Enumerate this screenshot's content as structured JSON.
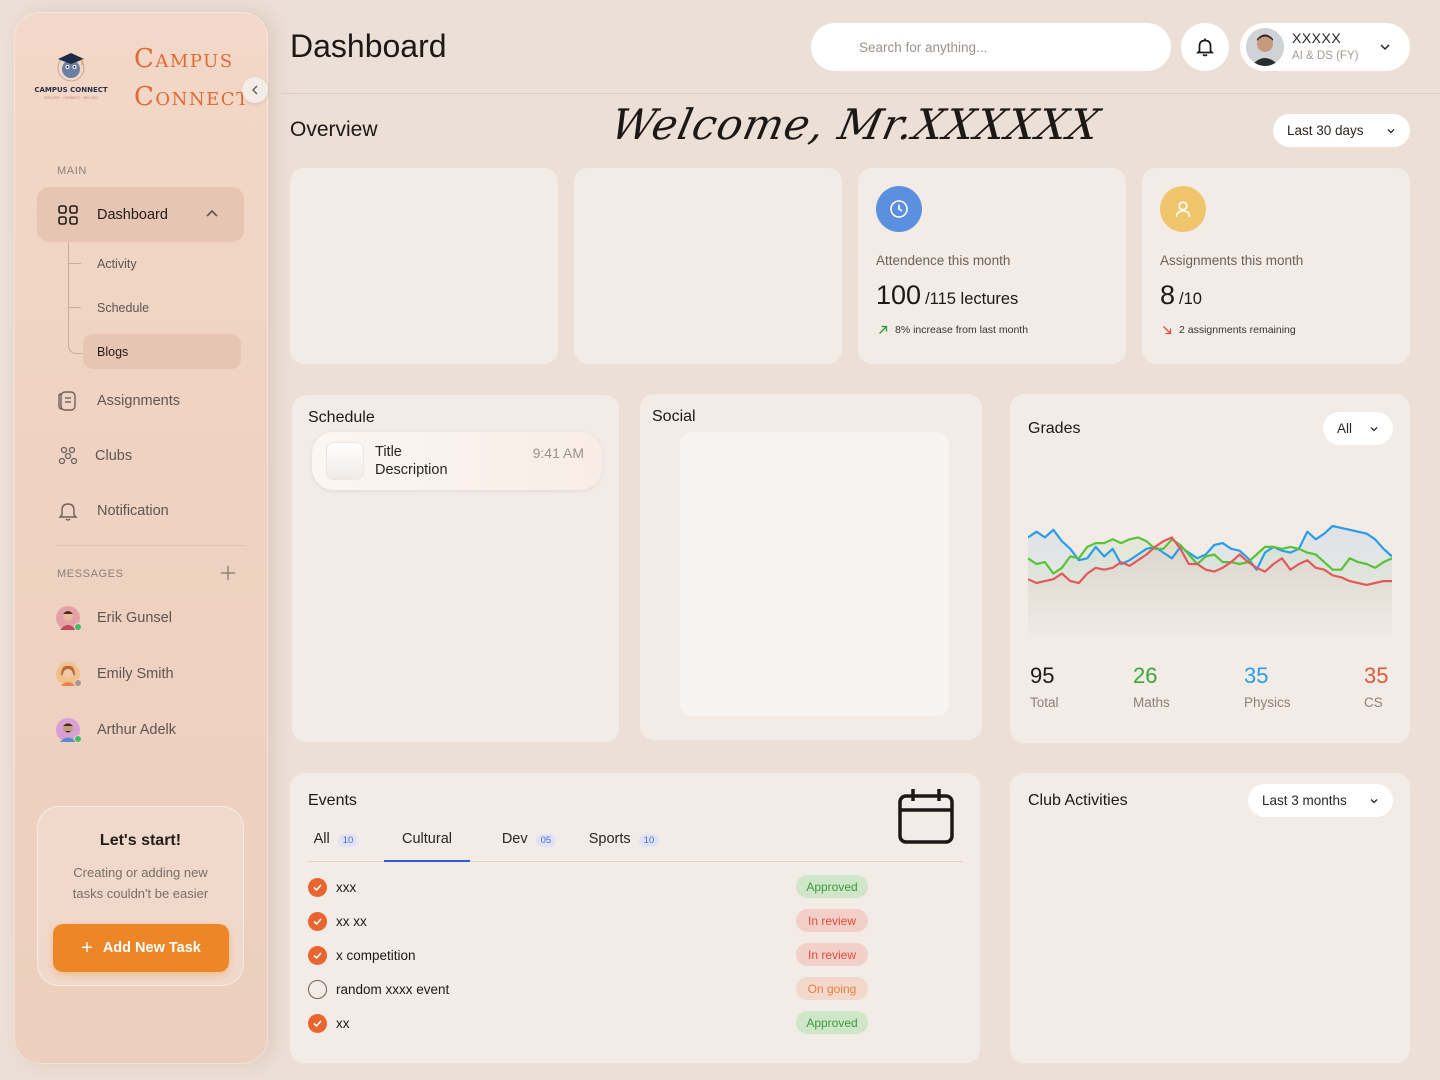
{
  "brand": {
    "line1": "Campus",
    "line2": "Connect",
    "emblem_text": "CAMPUS CONNECT",
    "tagline": "EXPLORE · CONNECT · BELONG"
  },
  "sidebar": {
    "main_label": "MAIN",
    "nav": [
      {
        "label": "Dashboard",
        "icon": "grid-icon",
        "active": true
      },
      {
        "label": "Assignments",
        "icon": "document-icon"
      },
      {
        "label": "Clubs",
        "icon": "people-icon"
      },
      {
        "label": "Notification",
        "icon": "bell-icon"
      }
    ],
    "sub_nav": [
      "Activity",
      "Schedule",
      "Blogs"
    ],
    "messages_label": "MESSAGES",
    "messages": [
      {
        "name": "Erik Gunsel",
        "status_color": "#3bbf5a"
      },
      {
        "name": "Emily Smith",
        "status_color": "#a39a94"
      },
      {
        "name": "Arthur Adelk",
        "status_color": "#3bbf5a"
      }
    ],
    "start_card": {
      "title": "Let's start!",
      "description": "Creating or adding new tasks couldn't be easier",
      "button": "Add New Task"
    }
  },
  "header": {
    "title": "Dashboard",
    "search_placeholder": "Search for anything...",
    "user": {
      "name": "XXXXX",
      "role": "AI & DS (FY)"
    }
  },
  "overview": {
    "title": "Overview",
    "welcome": "Welcome, Mr.XXXXXX",
    "range": "Last 30 days"
  },
  "stats": [
    {
      "label": "Attendence this month",
      "value": "100",
      "suffix": "/115 lectures",
      "trend": "8% increase from last month",
      "trend_dir": "up",
      "color": "#5b8fe0"
    },
    {
      "label": "Assignments this month",
      "value": "8",
      "suffix": "/10",
      "trend": "2 assignments remaining",
      "trend_dir": "down",
      "color": "#f0c56b"
    }
  ],
  "schedule": {
    "title": "Schedule",
    "items": [
      {
        "title": "Title",
        "description": "Description",
        "time": "9:41 AM"
      }
    ]
  },
  "social": {
    "title": "Social"
  },
  "grades": {
    "title": "Grades",
    "filter": "All",
    "totals": [
      {
        "value": "95",
        "label": "Total",
        "color": "#1c1816"
      },
      {
        "value": "26",
        "label": "Maths",
        "color": "#3aa63a"
      },
      {
        "value": "35",
        "label": "Physics",
        "color": "#2a9de8"
      },
      {
        "value": "35",
        "label": "CS",
        "color": "#e0593a"
      }
    ]
  },
  "chart_data": {
    "type": "area",
    "x": [
      0,
      1,
      2,
      3,
      4,
      5,
      6,
      7,
      8,
      9,
      10,
      11,
      12,
      13,
      14,
      15,
      16,
      17,
      18,
      19,
      20,
      21,
      22,
      23,
      24,
      25,
      26,
      27,
      28,
      29,
      30,
      31,
      32,
      33,
      34,
      35,
      36,
      37,
      38,
      39,
      40,
      41,
      42,
      43
    ],
    "series": [
      {
        "color": "#2a9de8",
        "values": [
          54,
          57,
          54,
          58,
          52,
          48,
          42,
          43,
          49,
          44,
          48,
          40,
          42,
          45,
          48,
          49,
          46,
          43,
          49,
          46,
          43,
          45,
          50,
          51,
          48,
          47,
          43,
          37,
          46,
          49,
          47,
          46,
          48,
          57,
          53,
          56,
          60,
          59,
          58,
          57,
          56,
          53,
          48,
          44
        ]
      },
      {
        "color": "#58c23a",
        "values": [
          43,
          40,
          41,
          35,
          38,
          44,
          43,
          49,
          51,
          51,
          53,
          51,
          53,
          54,
          52,
          48,
          48,
          53,
          50,
          45,
          40,
          44,
          45,
          41,
          41,
          40,
          41,
          45,
          49,
          49,
          48,
          49,
          48,
          46,
          45,
          41,
          37,
          37,
          43,
          41,
          40,
          38,
          41,
          43
        ]
      },
      {
        "color": "#e05a5a",
        "values": [
          32,
          30,
          31,
          32,
          35,
          31,
          30,
          35,
          38,
          37,
          38,
          41,
          39,
          42,
          45,
          49,
          52,
          54,
          48,
          40,
          40,
          37,
          36,
          38,
          41,
          45,
          41,
          38,
          36,
          40,
          43,
          37,
          40,
          42,
          38,
          37,
          34,
          33,
          31,
          30,
          29,
          30,
          31,
          31
        ]
      }
    ],
    "ylim": [
      0,
      100
    ],
    "grid": false,
    "legend": "none"
  },
  "events": {
    "title": "Events",
    "tabs": [
      {
        "label": "All",
        "count": "10",
        "active": false
      },
      {
        "label": "Cultural",
        "count": "",
        "active": true
      },
      {
        "label": "Dev",
        "count": "05",
        "active": false
      },
      {
        "label": "Sports",
        "count": "10",
        "active": false
      }
    ],
    "rows": [
      {
        "name": "xxx",
        "done": true,
        "status": "Approved"
      },
      {
        "name": "xx xx",
        "done": true,
        "status": "In review"
      },
      {
        "name": "x competition",
        "done": true,
        "status": "In review"
      },
      {
        "name": "random xxxx event",
        "done": false,
        "status": "On going"
      },
      {
        "name": "xx",
        "done": true,
        "status": "Approved"
      }
    ],
    "status_colors": {
      "Approved": {
        "bg": "#cfe6c8",
        "fg": "#3c9a3c"
      },
      "In review": {
        "bg": "#f3cfc9",
        "fg": "#e04b3a"
      },
      "On going": {
        "bg": "#f3d8cc",
        "fg": "#e6803e"
      }
    }
  },
  "clubs": {
    "title": "Club Activities",
    "range": "Last 3 months"
  }
}
